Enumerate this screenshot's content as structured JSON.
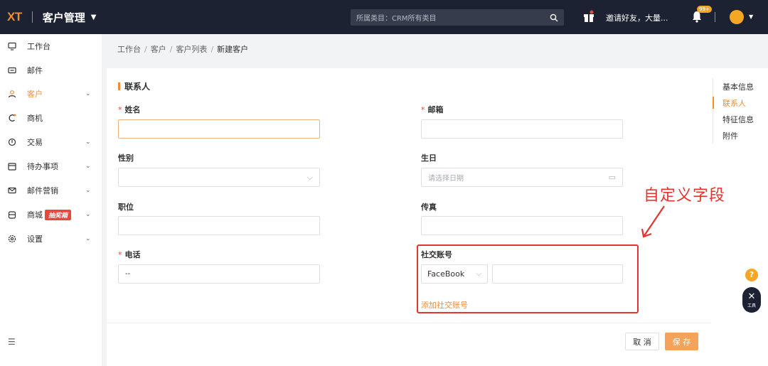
{
  "topbar": {
    "logo": "XT",
    "app_title": "客户管理",
    "search_placeholder": "所属类目：CRM所有类目",
    "invite_text": "邀请好友，大量...",
    "notification_badge": "99+"
  },
  "sidebar": {
    "items": [
      {
        "label": "工作台",
        "icon": "monitor-icon"
      },
      {
        "label": "邮件",
        "icon": "mail-icon"
      },
      {
        "label": "客户",
        "icon": "user-icon",
        "active": true
      },
      {
        "label": "商机",
        "icon": "opportunity-icon"
      },
      {
        "label": "交易",
        "icon": "deal-icon"
      },
      {
        "label": "待办事项",
        "icon": "calendar-icon"
      },
      {
        "label": "邮件营销",
        "icon": "mail-marketing-icon"
      },
      {
        "label": "商城",
        "icon": "store-icon",
        "tag": "抽奖箱"
      },
      {
        "label": "设置",
        "icon": "gear-icon"
      }
    ]
  },
  "breadcrumb": [
    "工作台",
    "客户",
    "客户列表",
    "新建客户"
  ],
  "section": {
    "title": "联系人",
    "fields": {
      "name": {
        "label": "姓名",
        "required": true,
        "value": ""
      },
      "email": {
        "label": "邮箱",
        "required": true,
        "value": ""
      },
      "gender": {
        "label": "性别",
        "value": ""
      },
      "birthday": {
        "label": "生日",
        "placeholder": "请选择日期"
      },
      "position": {
        "label": "职位",
        "value": ""
      },
      "fax": {
        "label": "传真",
        "value": ""
      },
      "phone": {
        "label": "电话",
        "required": true,
        "value": "--"
      },
      "social": {
        "label": "社交账号",
        "platform": "FaceBook",
        "add_label": "添加社交账号"
      }
    }
  },
  "annotation": "自定义字段",
  "anchor_nav": [
    "基本信息",
    "联系人",
    "特征信息",
    "附件"
  ],
  "anchor_active": "联系人",
  "floating": {
    "help": "?",
    "tool_label": "工具"
  },
  "footer": {
    "cancel": "取 消",
    "save": "保 存"
  },
  "colors": {
    "accent": "#f08c37",
    "header": "#1d2233",
    "annotation": "#e3342f"
  }
}
